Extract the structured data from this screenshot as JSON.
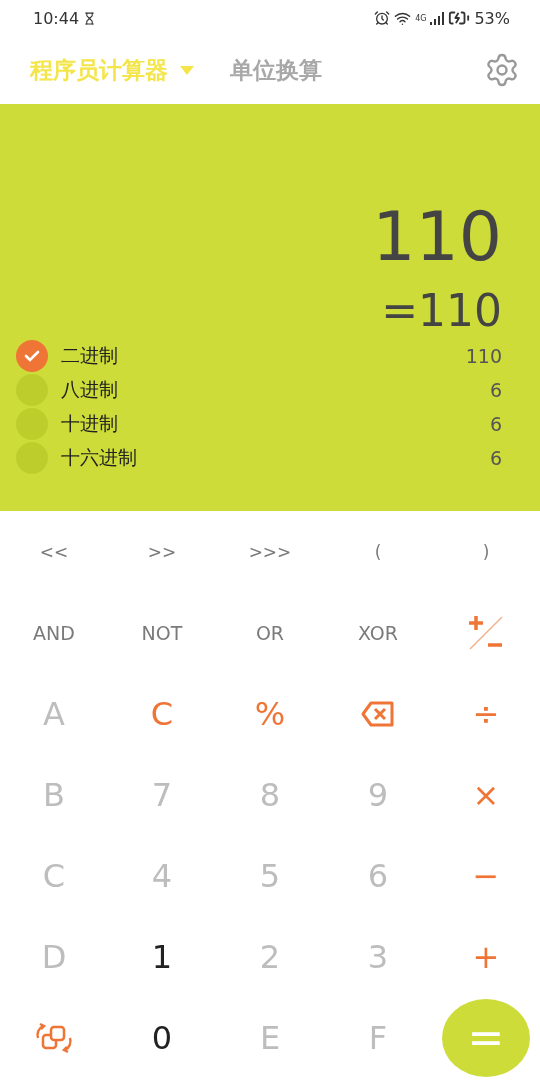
{
  "status_bar": {
    "time": "10:44",
    "network": "4G",
    "battery": "53%"
  },
  "header": {
    "tabs": [
      {
        "label": "程序员计算器",
        "selected": true,
        "dropdown": true
      },
      {
        "label": "单位换算",
        "selected": false,
        "dropdown": false
      }
    ]
  },
  "display": {
    "expression": "110",
    "result": "=110",
    "bases": [
      {
        "label": "二进制",
        "value": "110",
        "selected": true
      },
      {
        "label": "八进制",
        "value": "6",
        "selected": false
      },
      {
        "label": "十进制",
        "value": "6",
        "selected": false
      },
      {
        "label": "十六进制",
        "value": "6",
        "selected": false
      }
    ]
  },
  "keys": [
    {
      "kind": "small",
      "label": "<<"
    },
    {
      "kind": "small",
      "label": ">>"
    },
    {
      "kind": "small",
      "label": ">>>"
    },
    {
      "kind": "small",
      "label": "("
    },
    {
      "kind": "small",
      "label": ")"
    },
    {
      "kind": "func",
      "label": "AND"
    },
    {
      "kind": "func",
      "label": "NOT"
    },
    {
      "kind": "func",
      "label": "OR"
    },
    {
      "kind": "func",
      "label": "XOR"
    },
    {
      "kind": "sign"
    },
    {
      "kind": "digit",
      "label": "A",
      "disabled": true
    },
    {
      "kind": "action",
      "label": "C"
    },
    {
      "kind": "action",
      "label": "%"
    },
    {
      "kind": "backspace"
    },
    {
      "kind": "action",
      "label": "÷"
    },
    {
      "kind": "digit",
      "label": "B",
      "disabled": true
    },
    {
      "kind": "digit",
      "label": "7",
      "disabled": true
    },
    {
      "kind": "digit",
      "label": "8",
      "disabled": true
    },
    {
      "kind": "digit",
      "label": "9",
      "disabled": true
    },
    {
      "kind": "action",
      "label": "×"
    },
    {
      "kind": "digit",
      "label": "C",
      "disabled": true
    },
    {
      "kind": "digit",
      "label": "4",
      "disabled": true
    },
    {
      "kind": "digit",
      "label": "5",
      "disabled": true
    },
    {
      "kind": "digit",
      "label": "6",
      "disabled": true
    },
    {
      "kind": "action",
      "label": "−"
    },
    {
      "kind": "digit",
      "label": "D",
      "disabled": true
    },
    {
      "kind": "digit",
      "label": "1",
      "disabled": false
    },
    {
      "kind": "digit",
      "label": "2",
      "disabled": true
    },
    {
      "kind": "digit",
      "label": "3",
      "disabled": true
    },
    {
      "kind": "action",
      "label": "+"
    },
    {
      "kind": "swap"
    },
    {
      "kind": "digit",
      "label": "0",
      "disabled": false
    },
    {
      "kind": "digit",
      "label": "E",
      "disabled": true
    },
    {
      "kind": "digit",
      "label": "F",
      "disabled": true
    },
    {
      "kind": "equals",
      "label": "="
    }
  ]
}
